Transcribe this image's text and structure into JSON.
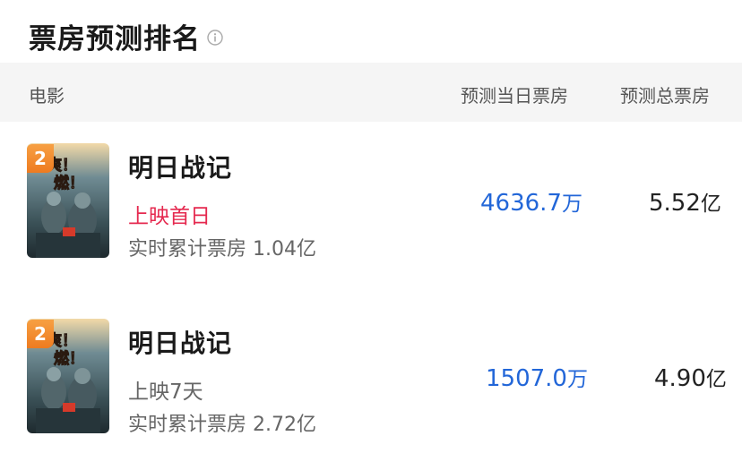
{
  "page": {
    "title": "票房预测排名",
    "info_icon": "info-icon"
  },
  "table": {
    "headers": {
      "movie": "电影",
      "today_box_office": "预测当日票房",
      "total_box_office": "预测总票房"
    },
    "rows": [
      {
        "rank_badge": "2",
        "poster_text": "爽！超燃！",
        "title": "明日战记",
        "status": "上映首日",
        "status_color": "#e5294f",
        "cumulative": "实时累计票房 1.04亿",
        "today_value": "4636.7",
        "today_unit": "万",
        "total_value": "5.52",
        "total_unit": "亿"
      },
      {
        "rank_badge": "2",
        "poster_text": "爽！超燃！",
        "title": "明日战记",
        "status": "上映7天",
        "status_color": "#666666",
        "cumulative": "实时累计票房 2.72亿",
        "today_value": "1507.0",
        "today_unit": "万",
        "total_value": "4.90",
        "total_unit": "亿"
      }
    ]
  },
  "colors": {
    "accent_blue": "#2266d8",
    "badge_orange": "#ee7b20",
    "status_red": "#e5294f"
  }
}
